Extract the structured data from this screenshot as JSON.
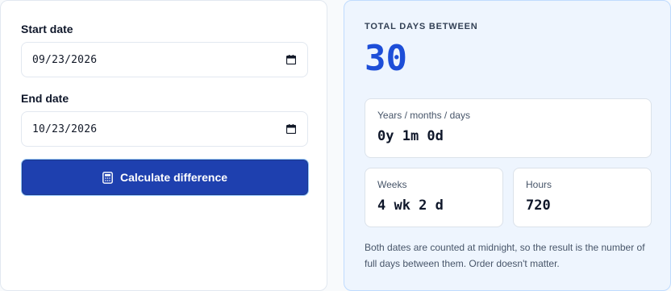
{
  "form": {
    "start_label": "Start date",
    "start_value": "09/23/2026",
    "end_label": "End date",
    "end_value": "10/23/2026",
    "calculate_label": "Calculate difference"
  },
  "result": {
    "total_label": "TOTAL DAYS BETWEEN",
    "total_value": "30",
    "ymd_label": "Years / months / days",
    "ymd_value": "0y 1m 0d",
    "weeks_label": "Weeks",
    "weeks_value": "4 wk 2 d",
    "hours_label": "Hours",
    "hours_value": "720",
    "note": "Both dates are counted at midnight, so the result is the number of full days between them. Order doesn't matter."
  },
  "icons": {
    "date_picker": "calendar-icon",
    "calculate": "calculator-icon"
  },
  "colors": {
    "accent": "#1e40af",
    "result_value": "#1d4ed8",
    "result_panel_bg": "#eef5fe"
  }
}
